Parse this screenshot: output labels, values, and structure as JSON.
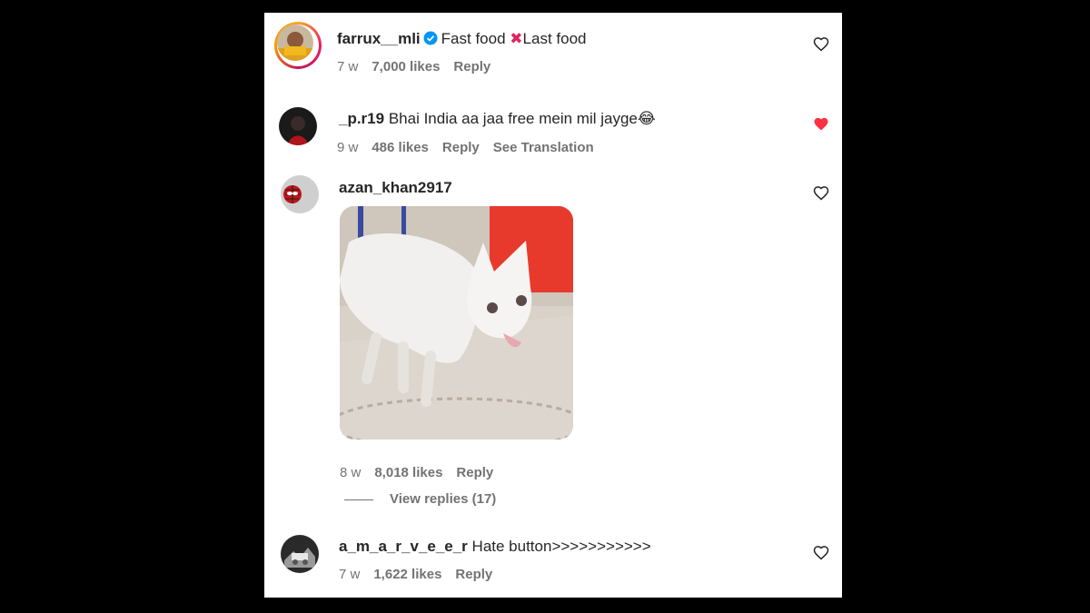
{
  "comments": [
    {
      "username": "farrux__mli",
      "verified": true,
      "text_before": "Fast food",
      "separator_emoji": "✖",
      "text_after": "Last food",
      "age": "7 w",
      "likes": "7,000 likes",
      "reply": "Reply",
      "liked": false
    },
    {
      "username": "_p.r19",
      "text": "Bhai India aa jaa free mein mil jayge😂",
      "age": "9 w",
      "likes": "486 likes",
      "reply": "Reply",
      "translation": "See Translation",
      "liked": true
    },
    {
      "username": "azan_khan2917",
      "text": "",
      "age": "8 w",
      "likes": "8,018 likes",
      "reply": "Reply",
      "view_replies": "View replies (17)",
      "liked": false
    },
    {
      "username": "a_m_a_r_v_e_e_r",
      "text": "Hate button>>>>>>>>>>>",
      "age": "7 w",
      "likes": "1,622 likes",
      "reply": "Reply",
      "liked": false
    }
  ],
  "colors": {
    "verified_blue": "#0095f6",
    "liked_red": "#ff3040",
    "meta_gray": "#737373"
  },
  "icons": {
    "like": "heart-outline-icon",
    "liked": "heart-filled-icon",
    "verified": "verified-badge-icon"
  }
}
